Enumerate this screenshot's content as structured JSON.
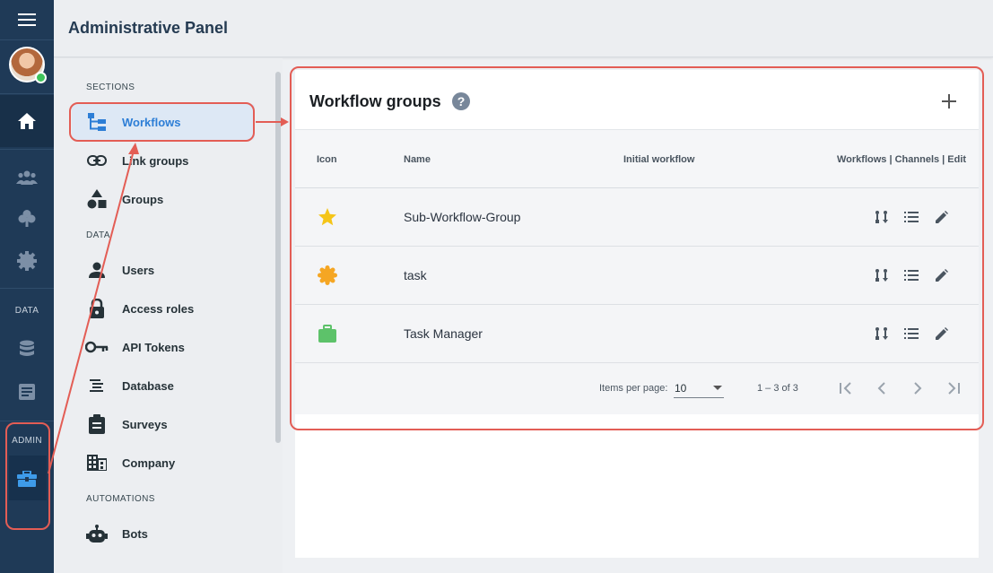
{
  "rail": {
    "data_label": "DATA",
    "admin_label": "ADMIN",
    "icons": [
      "menu-icon",
      "home-icon",
      "people-icon",
      "club-icon",
      "settings-icon",
      "database-icon",
      "document-icon",
      "toolbox-icon"
    ]
  },
  "header": {
    "title": "Administrative Panel"
  },
  "sections": {
    "heading_sections": "SECTIONS",
    "heading_data": "DATA",
    "heading_automations": "AUTOMATIONS",
    "items": [
      {
        "label": "Workflows",
        "icon": "workflow-tree-icon",
        "active": true
      },
      {
        "label": "Link groups",
        "icon": "link-icon"
      },
      {
        "label": "Groups",
        "icon": "shapes-icon"
      },
      {
        "label": "Users",
        "icon": "person-icon"
      },
      {
        "label": "Access roles",
        "icon": "lock-icon"
      },
      {
        "label": "API Tokens",
        "icon": "key-icon"
      },
      {
        "label": "Database",
        "icon": "database-lines-icon"
      },
      {
        "label": "Surveys",
        "icon": "clipboard-icon"
      },
      {
        "label": "Company",
        "icon": "building-icon"
      },
      {
        "label": "Bots",
        "icon": "robot-icon"
      }
    ]
  },
  "card": {
    "title": "Workflow groups",
    "help_glyph": "?",
    "columns": {
      "icon": "Icon",
      "name": "Name",
      "initial": "Initial workflow",
      "actions": "Workflows | Channels | Edit"
    },
    "rows": [
      {
        "name": "Sub-Workflow-Group",
        "icon": "star-icon",
        "color": "#f5c518"
      },
      {
        "name": "task",
        "icon": "badge-icon",
        "color": "#f5a623"
      },
      {
        "name": "Task Manager",
        "icon": "briefcase-icon",
        "color": "#5dc26a"
      }
    ],
    "footer": {
      "items_per_page_label": "Items per page:",
      "items_per_page_value": "10",
      "range": "1 – 3 of 3"
    }
  },
  "colors": {
    "rail": "#1f3a57",
    "accent": "#2d7ed6",
    "highlight": "#e35d55"
  }
}
